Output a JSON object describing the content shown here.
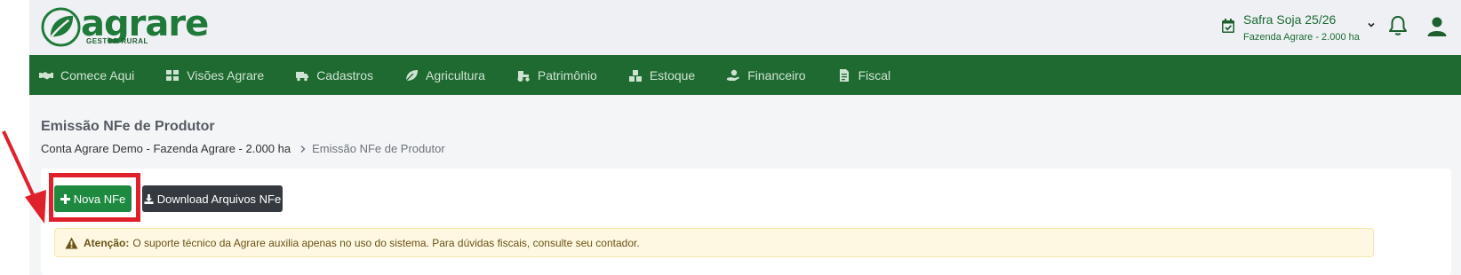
{
  "brand": {
    "name": "agrare",
    "tagline": "GESTOR RURAL",
    "color": "#1f7a3a"
  },
  "header": {
    "season_title": "Safra Soja 25/26",
    "season_farm": "Fazenda Agrare - 2.000 ha",
    "icons": [
      "calendar-check-icon",
      "chevron-down-icon",
      "bell-icon",
      "user-icon"
    ]
  },
  "nav": {
    "color": "#1f6a31",
    "items": [
      {
        "label": "Comece Aqui",
        "icon": "handshake-icon"
      },
      {
        "label": "Visões Agrare",
        "icon": "dashboard-icon"
      },
      {
        "label": "Cadastros",
        "icon": "truck-icon"
      },
      {
        "label": "Agricultura",
        "icon": "leaf-icon"
      },
      {
        "label": "Patrimônio",
        "icon": "tractor-icon"
      },
      {
        "label": "Estoque",
        "icon": "boxes-icon"
      },
      {
        "label": "Financeiro",
        "icon": "hand-money-icon"
      },
      {
        "label": "Fiscal",
        "icon": "file-invoice-icon"
      }
    ]
  },
  "page": {
    "title": "Emissão NFe de Produtor",
    "breadcrumb_root": "Conta Agrare Demo - Fazenda Agrare - 2.000 ha",
    "breadcrumb_current": "Emissão NFe de Produtor"
  },
  "actions": {
    "new_label": "Nova NFe",
    "download_label": "Download Arquivos NFe"
  },
  "alert": {
    "strong": "Atenção:",
    "text": "O suporte técnico da Agrare auxilia apenas no uso do sistema. Para dúvidas fiscais, consulte seu contador."
  },
  "annotation": {
    "color": "#e0202a"
  }
}
